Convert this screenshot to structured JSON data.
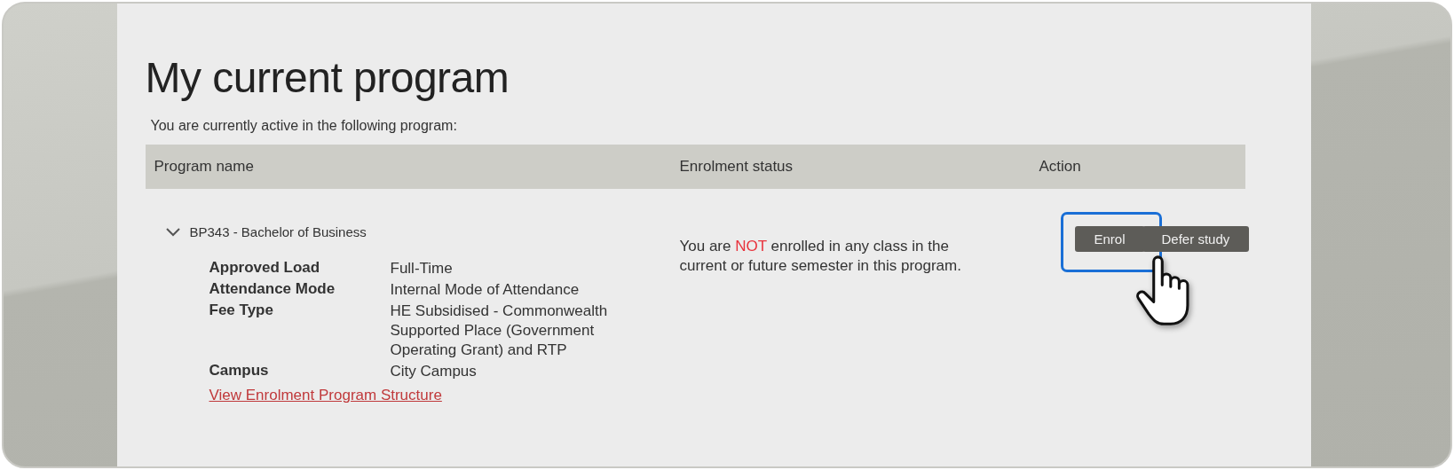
{
  "page": {
    "title": "My current program",
    "intro": "You are currently active in the following program:"
  },
  "table": {
    "columns": [
      "Program name",
      "Enrolment status",
      "Action"
    ],
    "rows": [
      {
        "program": "BP343 - Bachelor of Business",
        "expanded": true,
        "details": [
          {
            "label": "Approved Load",
            "value": "Full-Time"
          },
          {
            "label": "Attendance Mode",
            "value": "Internal Mode of Attendance"
          },
          {
            "label": "Fee Type",
            "value": "HE Subsidised - Commonwealth Supported Place (Government Operating Grant) and RTP"
          },
          {
            "label": "Campus",
            "value": "City Campus"
          }
        ],
        "link": "View Enrolment Program Structure",
        "status": {
          "before": "You are",
          "emphasis": "NOT",
          "after": "enrolled in any class in the current or future semester in this program."
        },
        "actions": [
          {
            "label": "Enrol",
            "highlighted": true
          },
          {
            "label": "Defer study",
            "highlighted": false
          }
        ]
      }
    ]
  }
}
